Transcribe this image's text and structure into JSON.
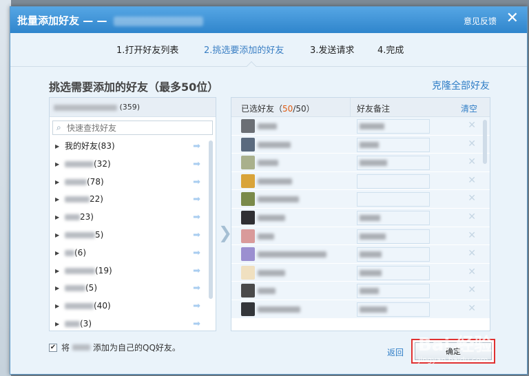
{
  "dialog": {
    "title": "批量添加好友 — —",
    "feedback": "意见反馈",
    "close": "✕"
  },
  "steps": [
    {
      "label": "1.打开好友列表"
    },
    {
      "label": "2.挑选要添加的好友"
    },
    {
      "label": "3.发送请求"
    },
    {
      "label": "4.完成"
    }
  ],
  "heading": "挑选需要添加的好友（最多50位）",
  "clone_all": "克隆全部好友",
  "left_panel": {
    "header_count": "(359)",
    "search_placeholder": "快速查找好友",
    "groups": [
      {
        "label": "我的好友(83)"
      },
      {
        "label": "(32)"
      },
      {
        "label": "(78)"
      },
      {
        "label": "22)"
      },
      {
        "label": "23)"
      },
      {
        "label": "5)"
      },
      {
        "label": "(6)"
      },
      {
        "label": "(19)"
      },
      {
        "label": "(5)"
      },
      {
        "label": "(40)"
      },
      {
        "label": "(3)"
      }
    ]
  },
  "right_panel": {
    "col_selected_prefix": "已选好友（",
    "selected_count": "50",
    "selected_suffix": "/50）",
    "col_remark": "好友备注",
    "clear": "清空"
  },
  "footer": {
    "checkbox_mark": "✔",
    "add_prefix": "将",
    "add_suffix": "添加为自己的QQ好友。",
    "back": "返回",
    "confirm": "确定"
  },
  "watermark": {
    "text": "Bai 经验",
    "url": "jingyan.baidu.com"
  }
}
